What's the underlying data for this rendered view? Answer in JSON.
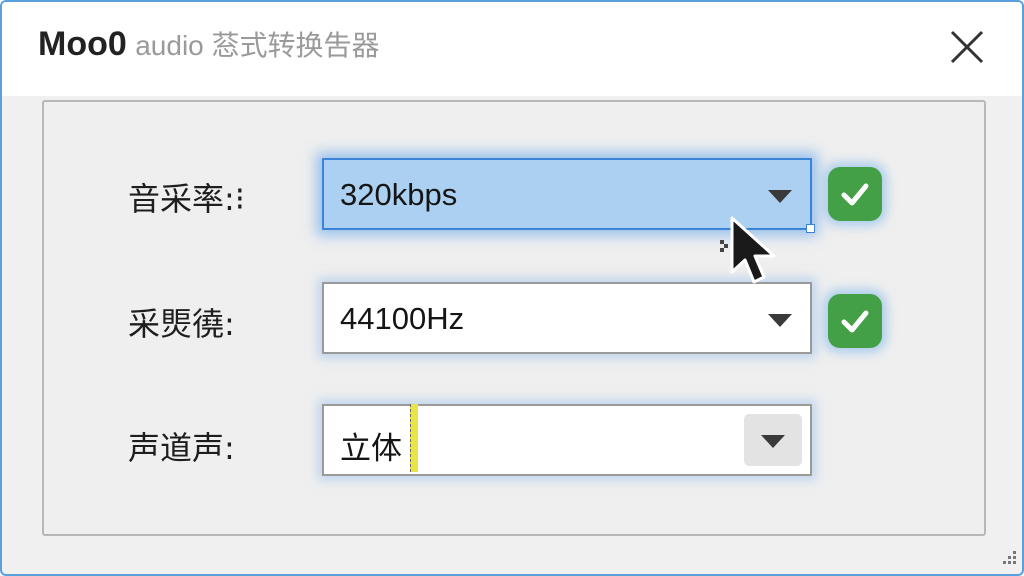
{
  "window": {
    "title_brand": "Moo0",
    "title_sub": "audio 䓗式转换吿器"
  },
  "rows": [
    {
      "label": "音采率:⁝",
      "value": "320kbps",
      "active": true,
      "confirmed": true
    },
    {
      "label": "采㷡徺:",
      "value": "44100Hz",
      "active": false,
      "confirmed": true
    },
    {
      "label": "声道声:",
      "value": "立体",
      "active": false,
      "confirmed": false
    }
  ],
  "icons": {
    "close": "close-icon",
    "dropdown": "chevron-down-icon",
    "confirm": "check-icon",
    "cursor": "mouse-pointer-icon",
    "resize": "resize-grip-icon"
  },
  "colors": {
    "window_border": "#5aa0dc",
    "active_select": "#acd0f1",
    "check_green": "#43a047"
  }
}
